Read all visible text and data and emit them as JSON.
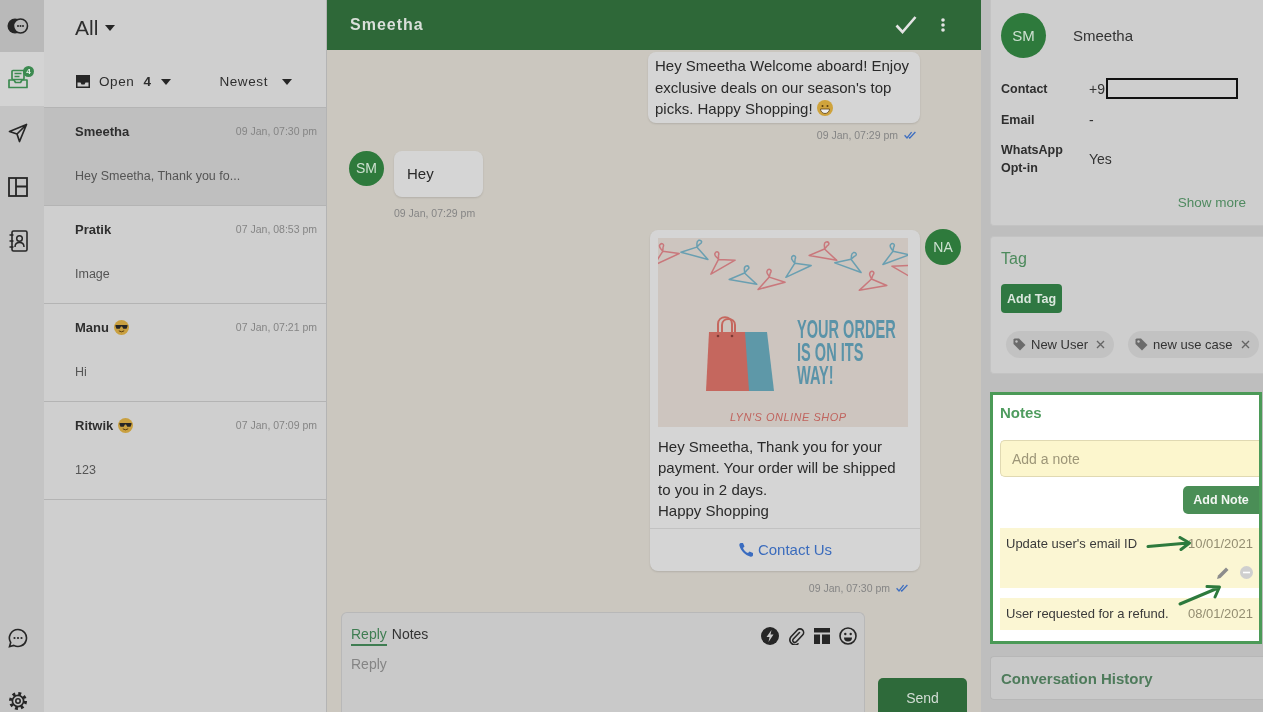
{
  "nav": {
    "items": [
      {
        "kind": "inbox",
        "selected": true,
        "badge": "4"
      },
      {
        "kind": "send",
        "selected": false
      },
      {
        "kind": "layout",
        "selected": false
      },
      {
        "kind": "contacts",
        "selected": false
      }
    ],
    "bottom": [
      {
        "kind": "chat"
      },
      {
        "kind": "settings"
      }
    ]
  },
  "conversations": {
    "filter": "All",
    "status": "Open",
    "count": "4",
    "sort": "Newest",
    "items": [
      {
        "name": "Smeetha",
        "emoji": false,
        "time": "09 Jan, 07:30 pm",
        "preview": "Hey Smeetha, Thank you fo...",
        "selected": true
      },
      {
        "name": "Pratik",
        "emoji": false,
        "time": "07 Jan, 08:53 pm",
        "preview": "Image",
        "selected": false
      },
      {
        "name": "Manu",
        "emoji": true,
        "time": "07 Jan, 07:21 pm",
        "preview": "Hi",
        "selected": false
      },
      {
        "name": "Ritwik",
        "emoji": true,
        "time": "07 Jan, 07:09 pm",
        "preview": "123",
        "selected": false
      }
    ]
  },
  "chat": {
    "title": "Smeetha",
    "messages": [
      {
        "kind": "outgoing",
        "text": "Hey Smeetha Welcome aboard! Enjoy exclusive deals on our season's top picks. Happy Shopping!",
        "emoji": true,
        "time": "09 Jan, 07:29 pm",
        "read": true
      },
      {
        "kind": "incoming",
        "avatar": "SM",
        "text": "Hey",
        "time": "09 Jan, 07:29 pm"
      },
      {
        "kind": "template",
        "avatar": "NA",
        "banner": {
          "headline": "YOUR ORDER IS ON ITS WAY!",
          "shop": "LYN'S ONLINE SHOP"
        },
        "text": "Hey Smeetha, Thank you for your payment. Your order will be shipped to you in 2 days.\nHappy Shopping",
        "button": "Contact Us",
        "time": "09 Jan, 07:30 pm",
        "read": true
      }
    ]
  },
  "composer": {
    "tabs": [
      {
        "label": "Reply",
        "selected": true
      },
      {
        "label": "Notes",
        "selected": false
      }
    ],
    "placeholder": "Reply",
    "send": "Send"
  },
  "contact": {
    "avatar": "SM",
    "name": "Smeetha",
    "fields": [
      {
        "label": "Contact",
        "value": "+9",
        "redacted": true
      },
      {
        "label": "Email",
        "value": "-",
        "redacted": false
      },
      {
        "label": "WhatsApp Opt-in",
        "value": "Yes",
        "redacted": false
      }
    ],
    "show_more": "Show more"
  },
  "tags": {
    "title": "Tag",
    "add_button": "Add Tag",
    "items": [
      {
        "label": "New User"
      },
      {
        "label": "new use case"
      }
    ]
  },
  "notes": {
    "title": "Notes",
    "highlighted": true,
    "placeholder": "Add a note",
    "add_button": "Add Note",
    "items": [
      {
        "text": "Update user's email ID",
        "date": "10/01/2021",
        "actions": true
      },
      {
        "text": "User requested for a refund.",
        "date": "08/01/2021",
        "actions": false
      }
    ]
  },
  "history": {
    "title": "Conversation History"
  }
}
